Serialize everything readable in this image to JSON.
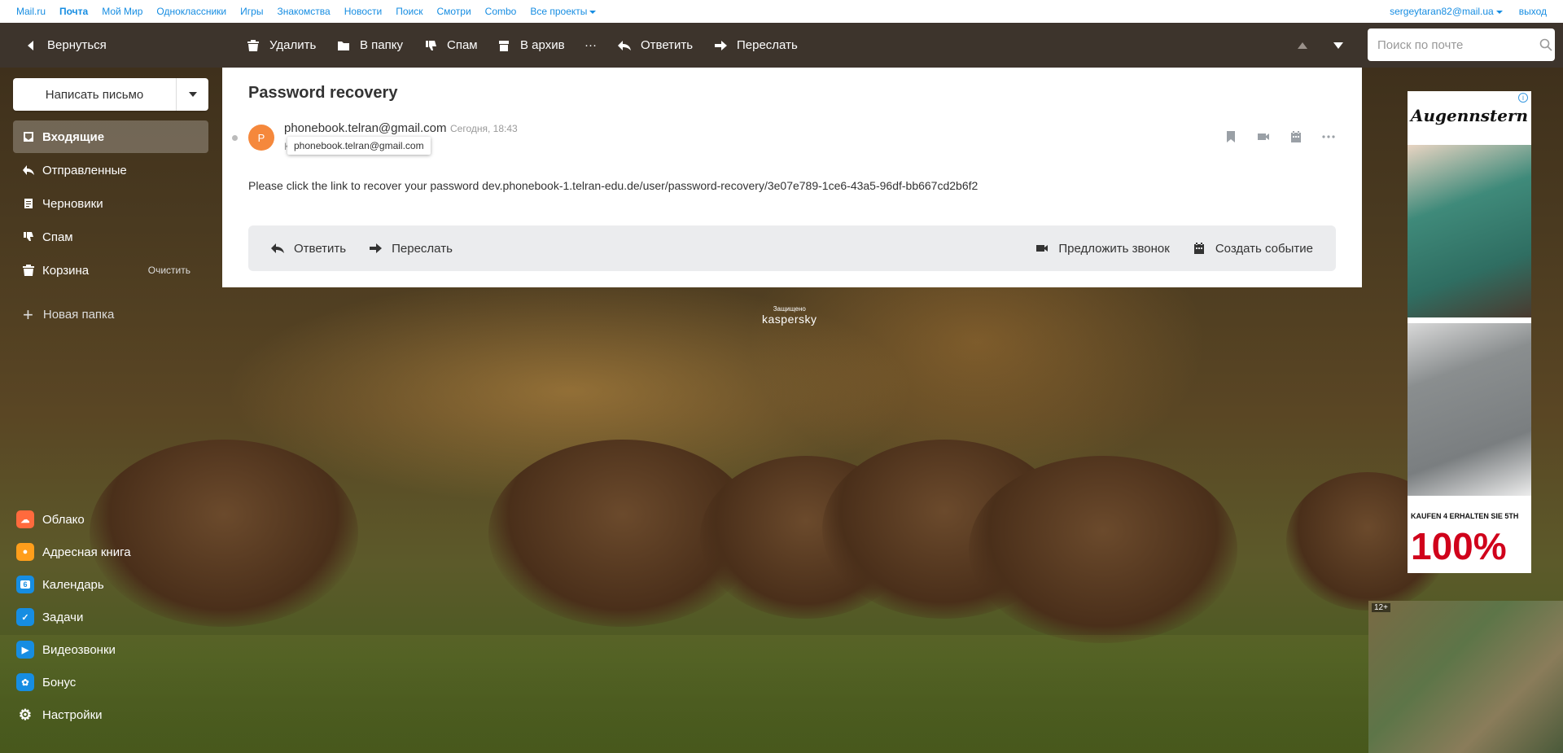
{
  "portal": {
    "links": [
      "Mail.ru",
      "Почта",
      "Мой Мир",
      "Одноклассники",
      "Игры",
      "Знакомства",
      "Новости",
      "Поиск",
      "Смотри",
      "Combo",
      "Все проекты"
    ],
    "account": "sergeytaran82@mail.ua",
    "logout": "выход"
  },
  "toolbar": {
    "back": "Вернуться",
    "delete": "Удалить",
    "move": "В папку",
    "spam": "Спам",
    "archive": "В архив",
    "more": "···",
    "reply": "Ответить",
    "forward": "Переслать",
    "search_placeholder": "Поиск по почте"
  },
  "sidebar": {
    "compose": "Написать письмо",
    "folders": [
      {
        "label": "Входящие",
        "icon": "inbox-icon"
      },
      {
        "label": "Отправленные",
        "icon": "sent-icon"
      },
      {
        "label": "Черновики",
        "icon": "drafts-icon"
      },
      {
        "label": "Спам",
        "icon": "spam-icon"
      },
      {
        "label": "Корзина",
        "icon": "trash-icon",
        "extra": "Очистить"
      }
    ],
    "new_folder": "Новая папка",
    "apps": [
      {
        "label": "Облако",
        "icon": "cloud-icon",
        "color": "#ff6a3d"
      },
      {
        "label": "Адресная книга",
        "icon": "contacts-icon",
        "color": "#ff9e1b"
      },
      {
        "label": "Календарь",
        "icon": "calendar-icon",
        "color": "#168de2",
        "glyph": "6"
      },
      {
        "label": "Задачи",
        "icon": "tasks-icon",
        "color": "#168de2"
      },
      {
        "label": "Видеозвонки",
        "icon": "video-icon",
        "color": "#168de2"
      },
      {
        "label": "Бонус",
        "icon": "bonus-icon",
        "color": "#168de2"
      },
      {
        "label": "Настройки",
        "icon": "settings-icon",
        "color": "transparent"
      }
    ]
  },
  "letter": {
    "subject": "Password recovery",
    "avatar_letter": "P",
    "from": "phonebook.telran@gmail.com",
    "date": "Сегодня, 18:43",
    "to_prefix": "К",
    "tooltip": "phonebook.telran@gmail.com",
    "body": "Please click the link to recover your password dev.phonebook-1.telran-edu.de/user/password-recovery/3e07e789-1ce6-43a5-96df-bb667cd2b6f2",
    "reply": "Ответить",
    "forward": "Переслать",
    "suggest_call": "Предложить звонок",
    "create_event": "Создать событие"
  },
  "kaspersky": {
    "small": "Защищено",
    "big": "kaspersky"
  },
  "ads": {
    "brand": "Augennstern",
    "promo": "KAUFEN 4 ERHALTEN SIE 5TH",
    "percent": "100%",
    "info": "i",
    "age": "12+"
  },
  "colors": {
    "accent": "#168de2",
    "toolbar": "#3d342c",
    "avatar": "#f5883c"
  }
}
